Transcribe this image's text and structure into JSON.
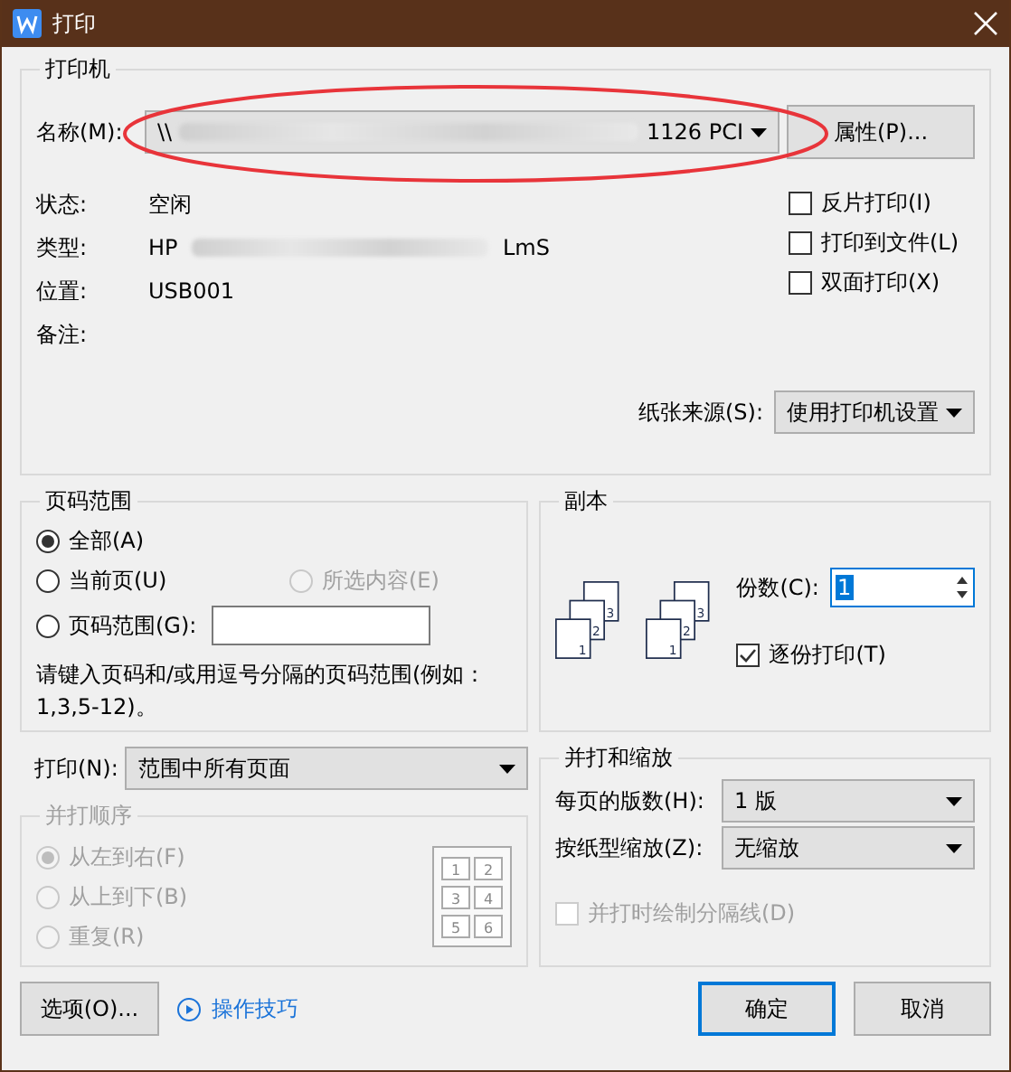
{
  "window": {
    "title": "打印"
  },
  "printer": {
    "title": "打印机",
    "name_label": "名称(M):",
    "name_start": "\\\\",
    "name_end": "1126 PCI",
    "properties_button": "属性(P)...",
    "info": [
      {
        "kind": "plain",
        "label": "状态:",
        "value": "空闲"
      },
      {
        "kind": "redacted",
        "label": "类型:",
        "value_start": "HP",
        "value_end": "LmS"
      },
      {
        "kind": "plain",
        "label": "位置:",
        "value": "USB001"
      },
      {
        "kind": "plain",
        "label": "备注:"
      }
    ],
    "options": [
      {
        "label": "反片打印(I)",
        "checked": false
      },
      {
        "label": "打印到文件(L)",
        "checked": false
      },
      {
        "label": "双面打印(X)",
        "checked": false
      }
    ],
    "paper_source_label": "纸张来源(S):",
    "paper_source_value": "使用打印机设置"
  },
  "page_range": {
    "title": "页码范围",
    "options": [
      {
        "label": "全部(A)",
        "selected": true,
        "disabled": false
      },
      {
        "label": "当前页(U)",
        "selected": false,
        "disabled": false
      },
      {
        "label": "所选内容(E)",
        "selected": false,
        "disabled": true
      },
      {
        "label": "页码范围(G):",
        "selected": false,
        "disabled": false
      }
    ],
    "hint": "请键入页码和/或用逗号分隔的页码范围(例如：1,3,5-12)。"
  },
  "copies": {
    "title": "副本",
    "stacks": [
      {
        "pages": [
          "3",
          "2",
          "1"
        ]
      },
      {
        "pages": [
          "3",
          "2",
          "1"
        ]
      }
    ],
    "count_label": "份数(C):",
    "count_value": "1",
    "collate": {
      "label": "逐份打印(T)",
      "checked": true
    }
  },
  "print": {
    "label": "打印(N):",
    "value": "范围中所有页面"
  },
  "order": {
    "title": "并打顺序",
    "disabled": true,
    "options": [
      {
        "label": "从左到右(F)",
        "selected": true
      },
      {
        "label": "从上到下(B)",
        "selected": false
      },
      {
        "label": "重复(R)",
        "selected": false
      }
    ],
    "preview_pages": [
      "1",
      "2",
      "3",
      "4",
      "5",
      "6"
    ]
  },
  "zoom": {
    "title": "并打和缩放",
    "pages_label": "每页的版数(H):",
    "pages_value": "1 版",
    "scale_label": "按纸型缩放(Z):",
    "scale_value": "无缩放",
    "separator": {
      "label": "并打时绘制分隔线(D)",
      "checked": false,
      "disabled": true
    }
  },
  "footer": {
    "options_button": "选项(O)...",
    "tips_link": "操作技巧",
    "ok_button": "确定",
    "cancel_button": "取消"
  }
}
